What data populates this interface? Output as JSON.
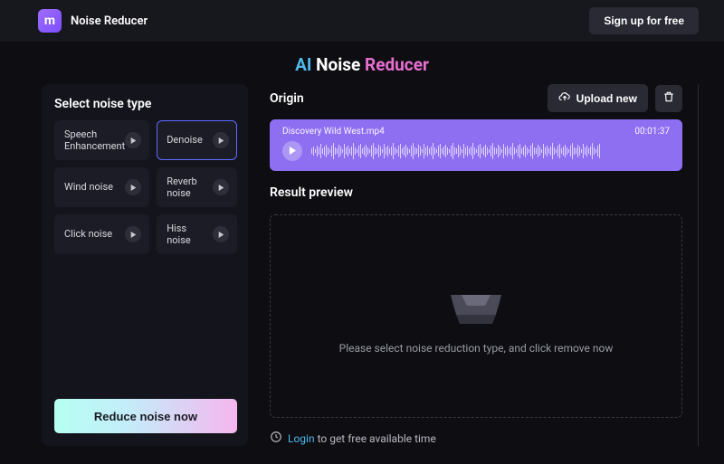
{
  "brand": "Noise Reducer",
  "header": {
    "signup_label": "Sign up for free"
  },
  "hero": {
    "ai": "AI ",
    "noise": "Noise ",
    "reducer": "Reducer"
  },
  "sidebar": {
    "title": "Select noise type",
    "items": [
      {
        "label": "Speech Enhancement"
      },
      {
        "label": "Denoise"
      },
      {
        "label": "Wind noise"
      },
      {
        "label": "Reverb noise"
      },
      {
        "label": "Click noise"
      },
      {
        "label": "Hiss noise"
      }
    ],
    "reduce_label": "Reduce noise now"
  },
  "origin": {
    "title": "Origin",
    "upload_label": "Upload new",
    "file_name": "Discovery Wild West.mp4",
    "duration": "00:01:37"
  },
  "result": {
    "title": "Result preview",
    "placeholder": "Please select noise reduction type, and click remove now"
  },
  "footer": {
    "login": "Login",
    "rest": " to get free available time"
  }
}
